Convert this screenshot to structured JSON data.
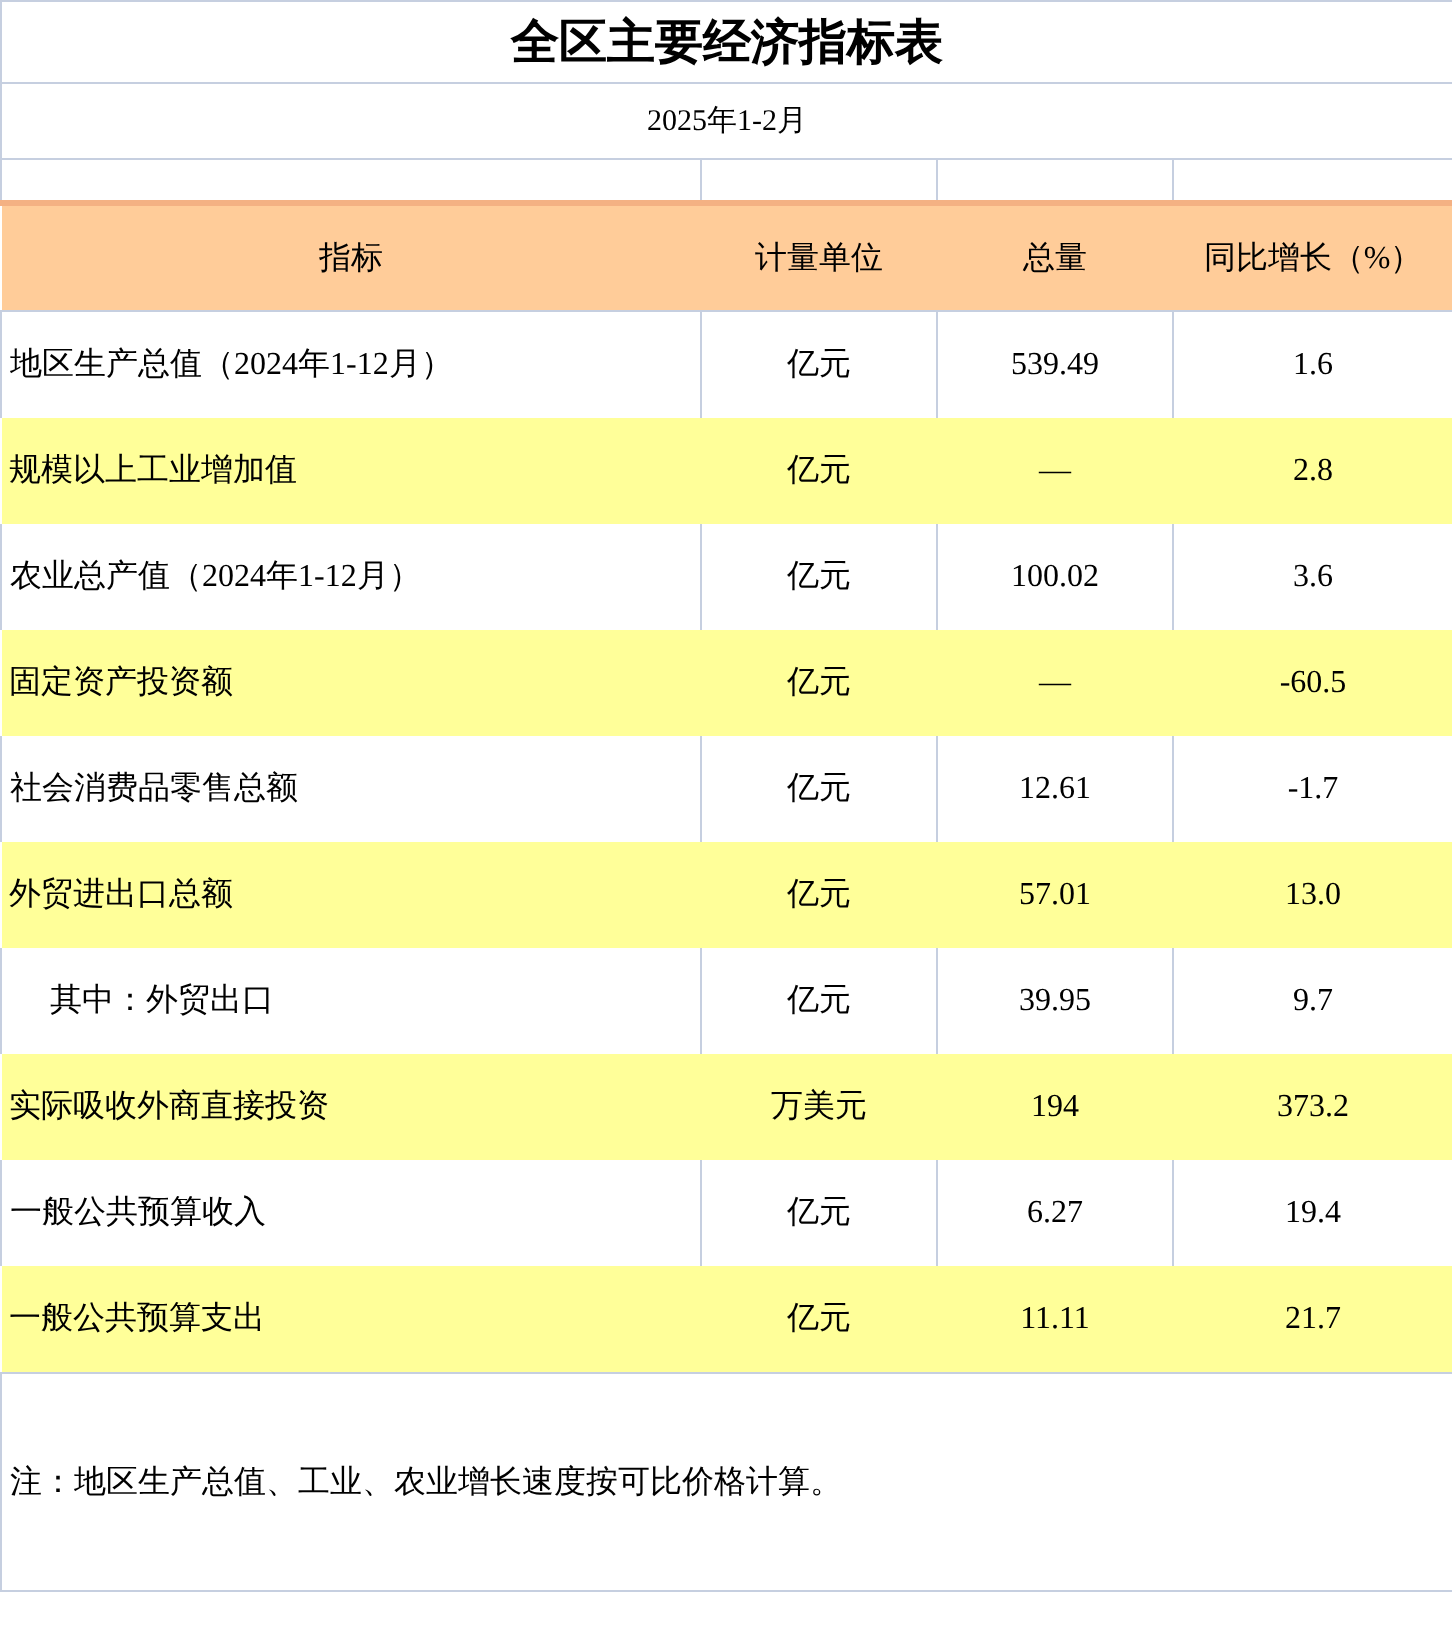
{
  "title": "全区主要经济指标表",
  "period": "2025年1-2月",
  "columns": [
    "指标",
    "计量单位",
    "总量",
    "同比增长（%）"
  ],
  "rows": [
    {
      "kind": "main",
      "highlighted": false,
      "indicator": "地区生产总值（2024年1-12月）",
      "unit": "亿元",
      "total": "539.49",
      "growth": "1.6"
    },
    {
      "kind": "main",
      "highlighted": true,
      "indicator": "规模以上工业增加值",
      "unit": "亿元",
      "total": "—",
      "growth": "2.8"
    },
    {
      "kind": "main",
      "highlighted": false,
      "indicator": "农业总产值（2024年1-12月）",
      "unit": "亿元",
      "total": "100.02",
      "growth": "3.6"
    },
    {
      "kind": "main",
      "highlighted": true,
      "indicator": "固定资产投资额",
      "unit": "亿元",
      "total": "—",
      "growth": "-60.5"
    },
    {
      "kind": "main",
      "highlighted": false,
      "indicator": "社会消费品零售总额",
      "unit": "亿元",
      "total": "12.61",
      "growth": "-1.7"
    },
    {
      "kind": "main",
      "highlighted": true,
      "indicator": "外贸进出口总额",
      "unit": "亿元",
      "total": "57.01",
      "growth": "13.0"
    },
    {
      "kind": "sub",
      "highlighted": false,
      "indicator": "其中：外贸出口",
      "unit": "亿元",
      "total": "39.95",
      "growth": "9.7"
    },
    {
      "kind": "main",
      "highlighted": true,
      "indicator": "实际吸收外商直接投资",
      "unit": "万美元",
      "total": "194",
      "growth": "373.2"
    },
    {
      "kind": "main",
      "highlighted": false,
      "indicator": "一般公共预算收入",
      "unit": "亿元",
      "total": "6.27",
      "growth": "19.4"
    },
    {
      "kind": "main",
      "highlighted": true,
      "indicator": "一般公共预算支出",
      "unit": "亿元",
      "total": "11.11",
      "growth": "21.7"
    }
  ],
  "note": "注：地区生产总值、工业、农业增长速度按可比价格计算。"
}
